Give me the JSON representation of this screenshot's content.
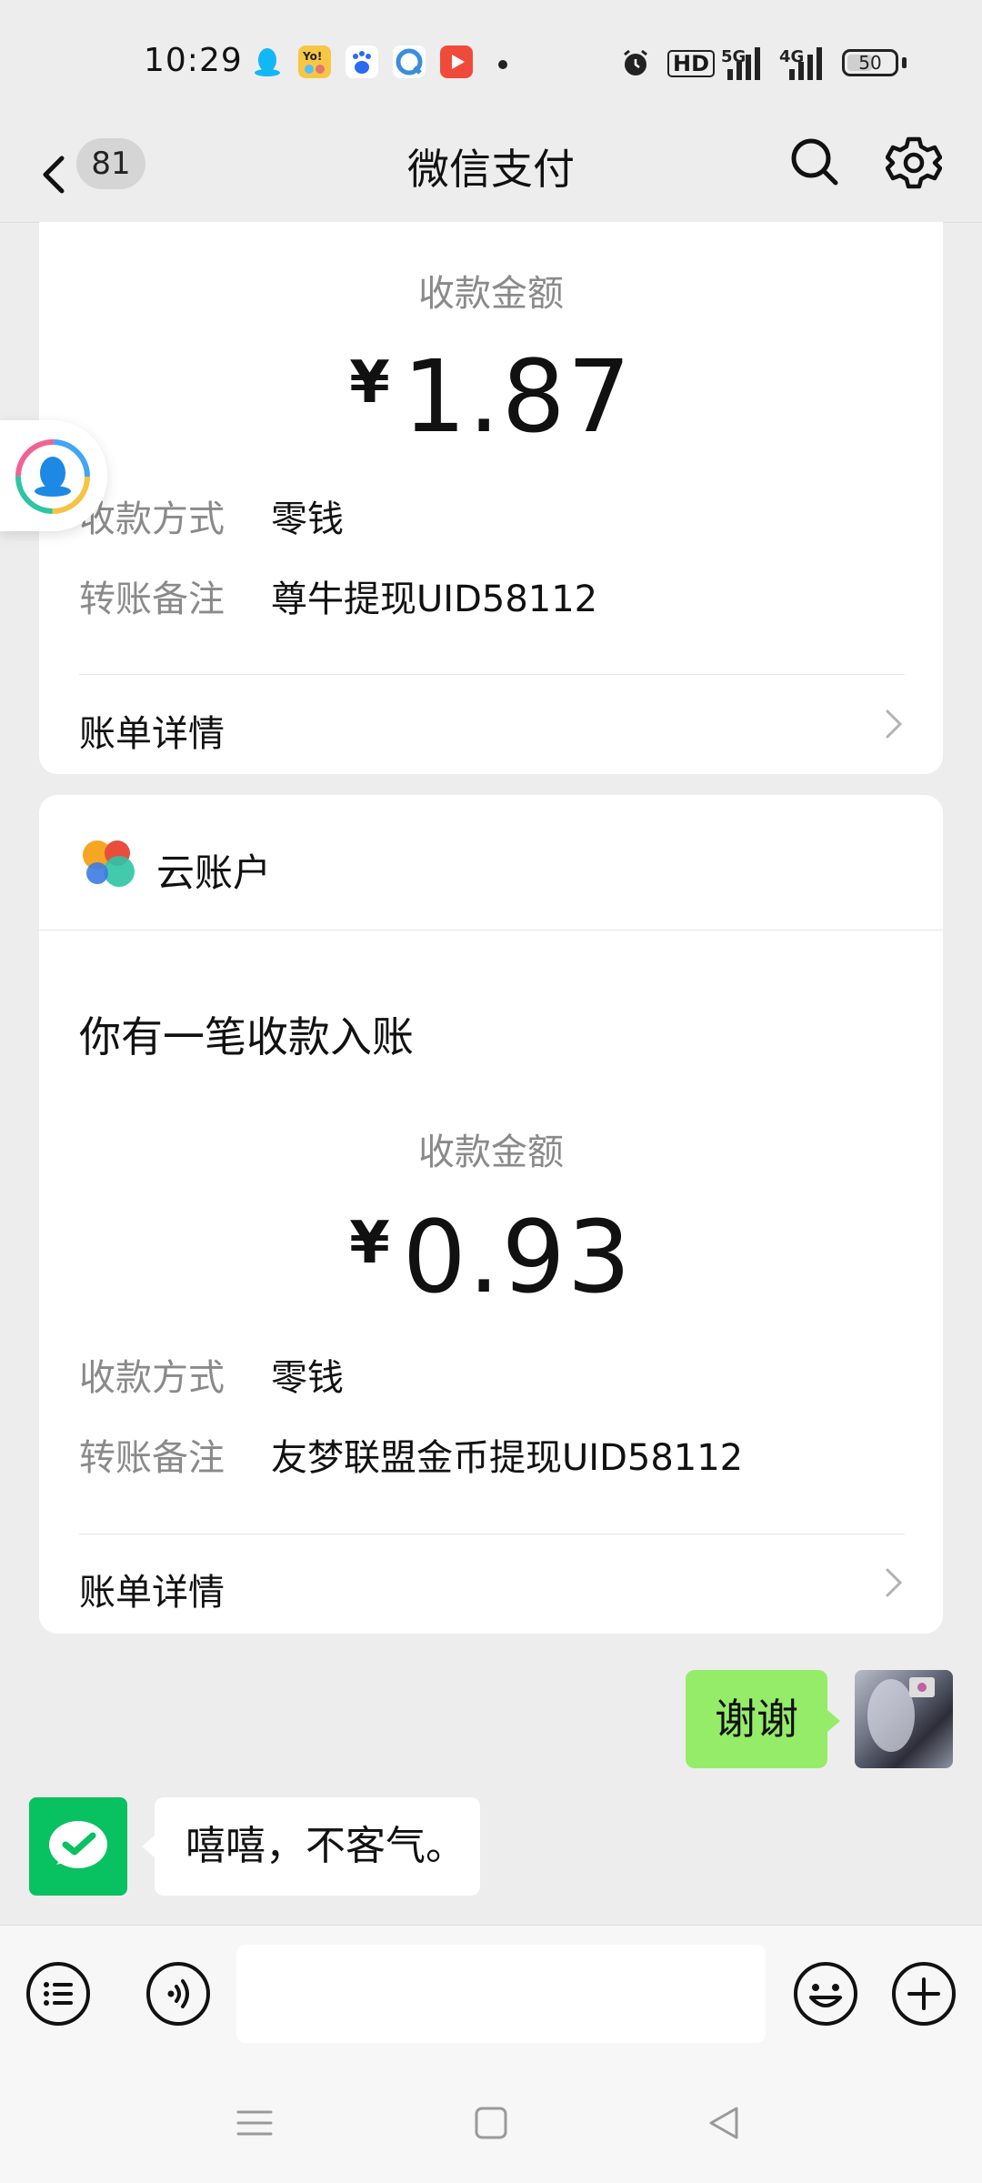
{
  "status_bar": {
    "time": "10:29",
    "app_icons": [
      {
        "name": "qq-icon",
        "color": "#12b7f5"
      },
      {
        "name": "yo-app-icon",
        "color": "#f7c744"
      },
      {
        "name": "baidu-icon",
        "color": "#2a6bf2"
      },
      {
        "name": "browser-icon",
        "color": "#3a8dde"
      },
      {
        "name": "video-icon",
        "color": "#f04b3a"
      }
    ],
    "hd_label": "HD",
    "signal_1": "5G",
    "signal_2": "4G",
    "battery": "50"
  },
  "nav": {
    "unread_count": "81",
    "title": "微信支付"
  },
  "cards": [
    {
      "amount_label": "收款金额",
      "currency": "¥",
      "amount": "1.87",
      "method_label": "收款方式",
      "method_value": "零钱",
      "note_label": "转账备注",
      "note_value": "尊牛提现UID58112",
      "detail_label": "账单详情"
    },
    {
      "account_name": "云账户",
      "notice": "你有一笔收款入账",
      "amount_label": "收款金额",
      "currency": "¥",
      "amount": "0.93",
      "method_label": "收款方式",
      "method_value": "零钱",
      "note_label": "转账备注",
      "note_value": "友梦联盟金币提现UID58112",
      "detail_label": "账单详情"
    }
  ],
  "chat": {
    "my_message": "谢谢",
    "reply_message": "嘻嘻，不客气。"
  },
  "input": {
    "placeholder": ""
  },
  "colors": {
    "background": "#ededed",
    "my_bubble": "#95ec69",
    "wechat_pay_green": "#08c160"
  }
}
